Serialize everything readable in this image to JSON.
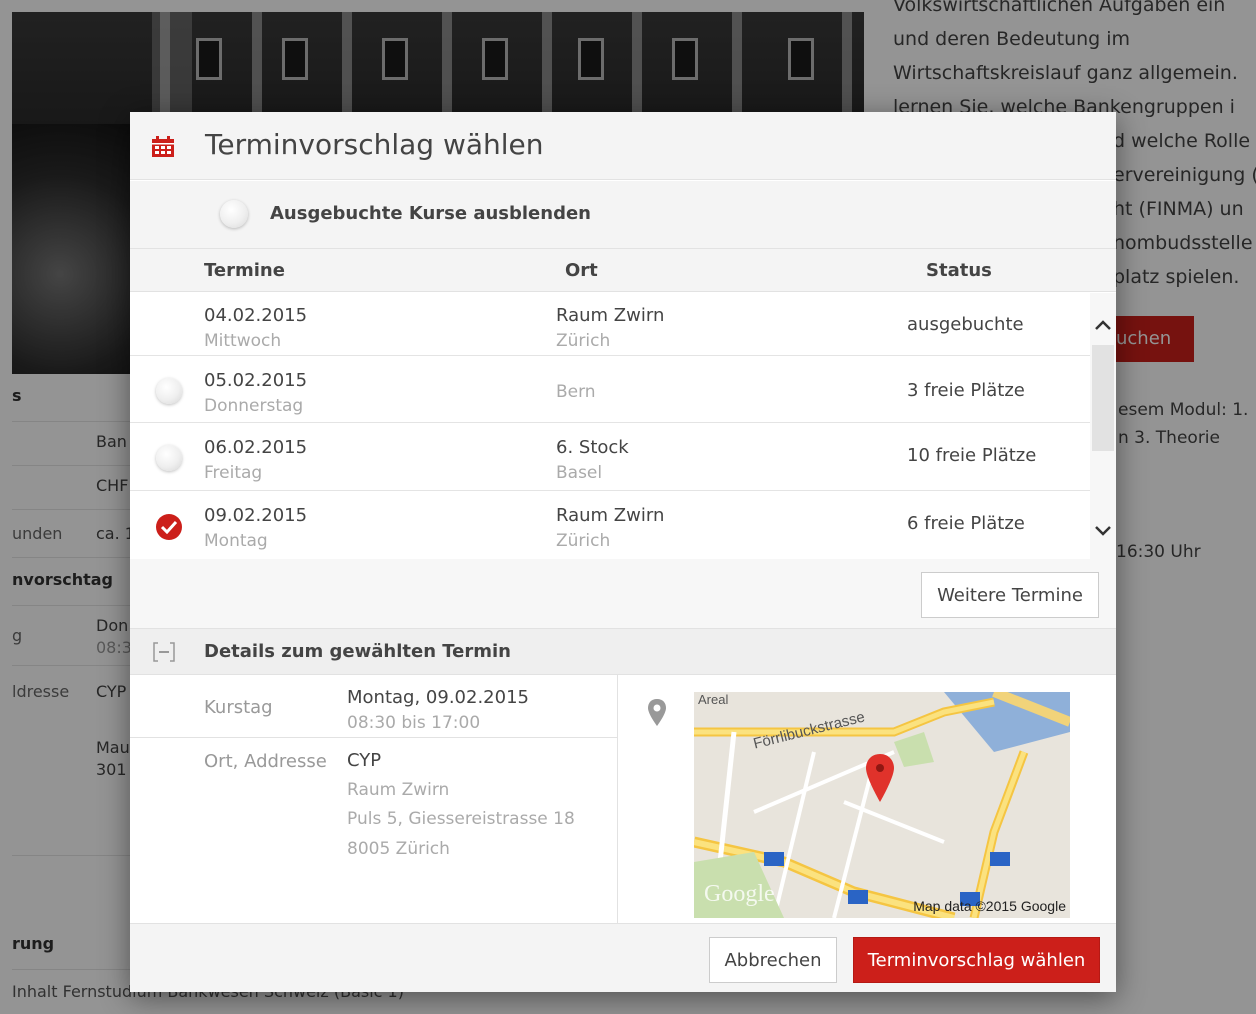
{
  "background": {
    "right_text": [
      "Volkswirtschaftlichen Aufgaben ein",
      "und deren Bedeutung im",
      "Wirtschaftskreislauf ganz allgemein.",
      "lernen Sie, welche Bankengruppen i",
      "d welche Rolle",
      "ervereinigung (",
      "ht (FINMA) un",
      "nombudsstelle",
      "platz spielen."
    ],
    "book_button": "uchen",
    "right_info": [
      "esem Modul: 1.",
      "n 3. Theorie"
    ],
    "right_time": "16:30 Uhr",
    "left_rows": [
      {
        "label": "s",
        "value": "",
        "section": true
      },
      {
        "label": "",
        "value": "Ban"
      },
      {
        "label": "",
        "value": "CHF"
      },
      {
        "label": "unden",
        "value": "ca. 1"
      },
      {
        "label": "nvorschtag",
        "value": "",
        "section": true
      },
      {
        "label": "g",
        "value": "Don",
        "sub": "08:3"
      },
      {
        "label": "ldresse",
        "value": "CYP"
      },
      {
        "label": "",
        "value": "Mau",
        "sub": "301"
      },
      {
        "label": "rung",
        "value": "",
        "section": true
      }
    ],
    "bottom_text": "Inhalt Fernstudium Bankwesen Schweiz (Basic 1)"
  },
  "modal": {
    "title": "Terminvorschlag wählen",
    "filter_label": "Ausgebuchte Kurse ausblenden",
    "columns": {
      "termine": "Termine",
      "ort": "Ort",
      "status": "Status"
    },
    "rows": [
      {
        "date": "04.02.2015",
        "day": "Mittwoch",
        "ort1": "Raum Zwirn",
        "ort2": "Zürich",
        "status": "ausgebuchte",
        "radio": "none"
      },
      {
        "date": "05.02.2015",
        "day": "Donnerstag",
        "ort1": "",
        "ort2": "Bern",
        "status": "3 freie Plätze",
        "radio": "unchecked"
      },
      {
        "date": "06.02.2015",
        "day": "Freitag",
        "ort1": "6. Stock",
        "ort2": "Basel",
        "status": "10 freie Plätze",
        "radio": "unchecked"
      },
      {
        "date": "09.02.2015",
        "day": "Montag",
        "ort1": "Raum Zwirn",
        "ort2": "Zürich",
        "status": "6 freie Plätze",
        "radio": "checked"
      }
    ],
    "more_button": "Weitere Termine",
    "details_title": "Details zum gewählten Termin",
    "details": {
      "kurstag_label": "Kurstag",
      "kurstag_value": "Montag, 09.02.2015",
      "kurstag_time": "08:30 bis 17:00",
      "ort_label": "Ort, Addresse",
      "ort_name": "CYP",
      "ort_lines": [
        "Raum Zwirn",
        "Puls 5, Giessereistrasse 18",
        "8005 Zürich"
      ]
    },
    "map": {
      "street": "Förrlibuckstrasse",
      "area": "Areal",
      "google": "Google",
      "credit": "Map data ©2015 Google"
    },
    "cancel_button": "Abbrechen",
    "confirm_button": "Terminvorschlag wählen"
  },
  "colors": {
    "accent": "#cc1f1a"
  }
}
